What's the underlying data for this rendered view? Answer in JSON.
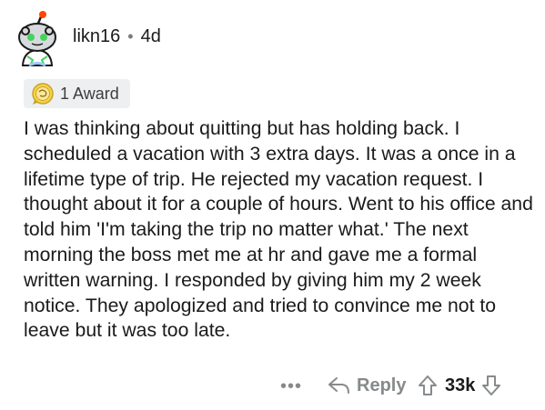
{
  "comment": {
    "author": "likn16",
    "separator": "•",
    "age": "4d",
    "award_count_label": "1 Award",
    "body": "I was thinking about quitting but has holding back. I scheduled a vacation with 3 extra days. It was a once in a lifetime type of trip. He rejected my vacation request. I thought about it for a couple of hours. Went to his office and told him 'I'm taking the trip no matter what.' The next morning the boss met me at hr and gave me a formal written warning. I responded by giving him my 2 week notice. They apologized and tried to convince me not to leave but it was too late."
  },
  "actions": {
    "more_label": "•••",
    "reply_label": "Reply",
    "score": "33k"
  },
  "icons": {
    "avatar": "snoo-avatar-icon",
    "award": "award-medal-icon",
    "reply": "reply-arrow-icon",
    "upvote": "upvote-arrow-icon",
    "downvote": "downvote-arrow-icon"
  },
  "colors": {
    "award_bg": "#edeff1",
    "muted": "#878a8c",
    "text": "#1a1a1b",
    "avatar_green": "#46d160"
  }
}
